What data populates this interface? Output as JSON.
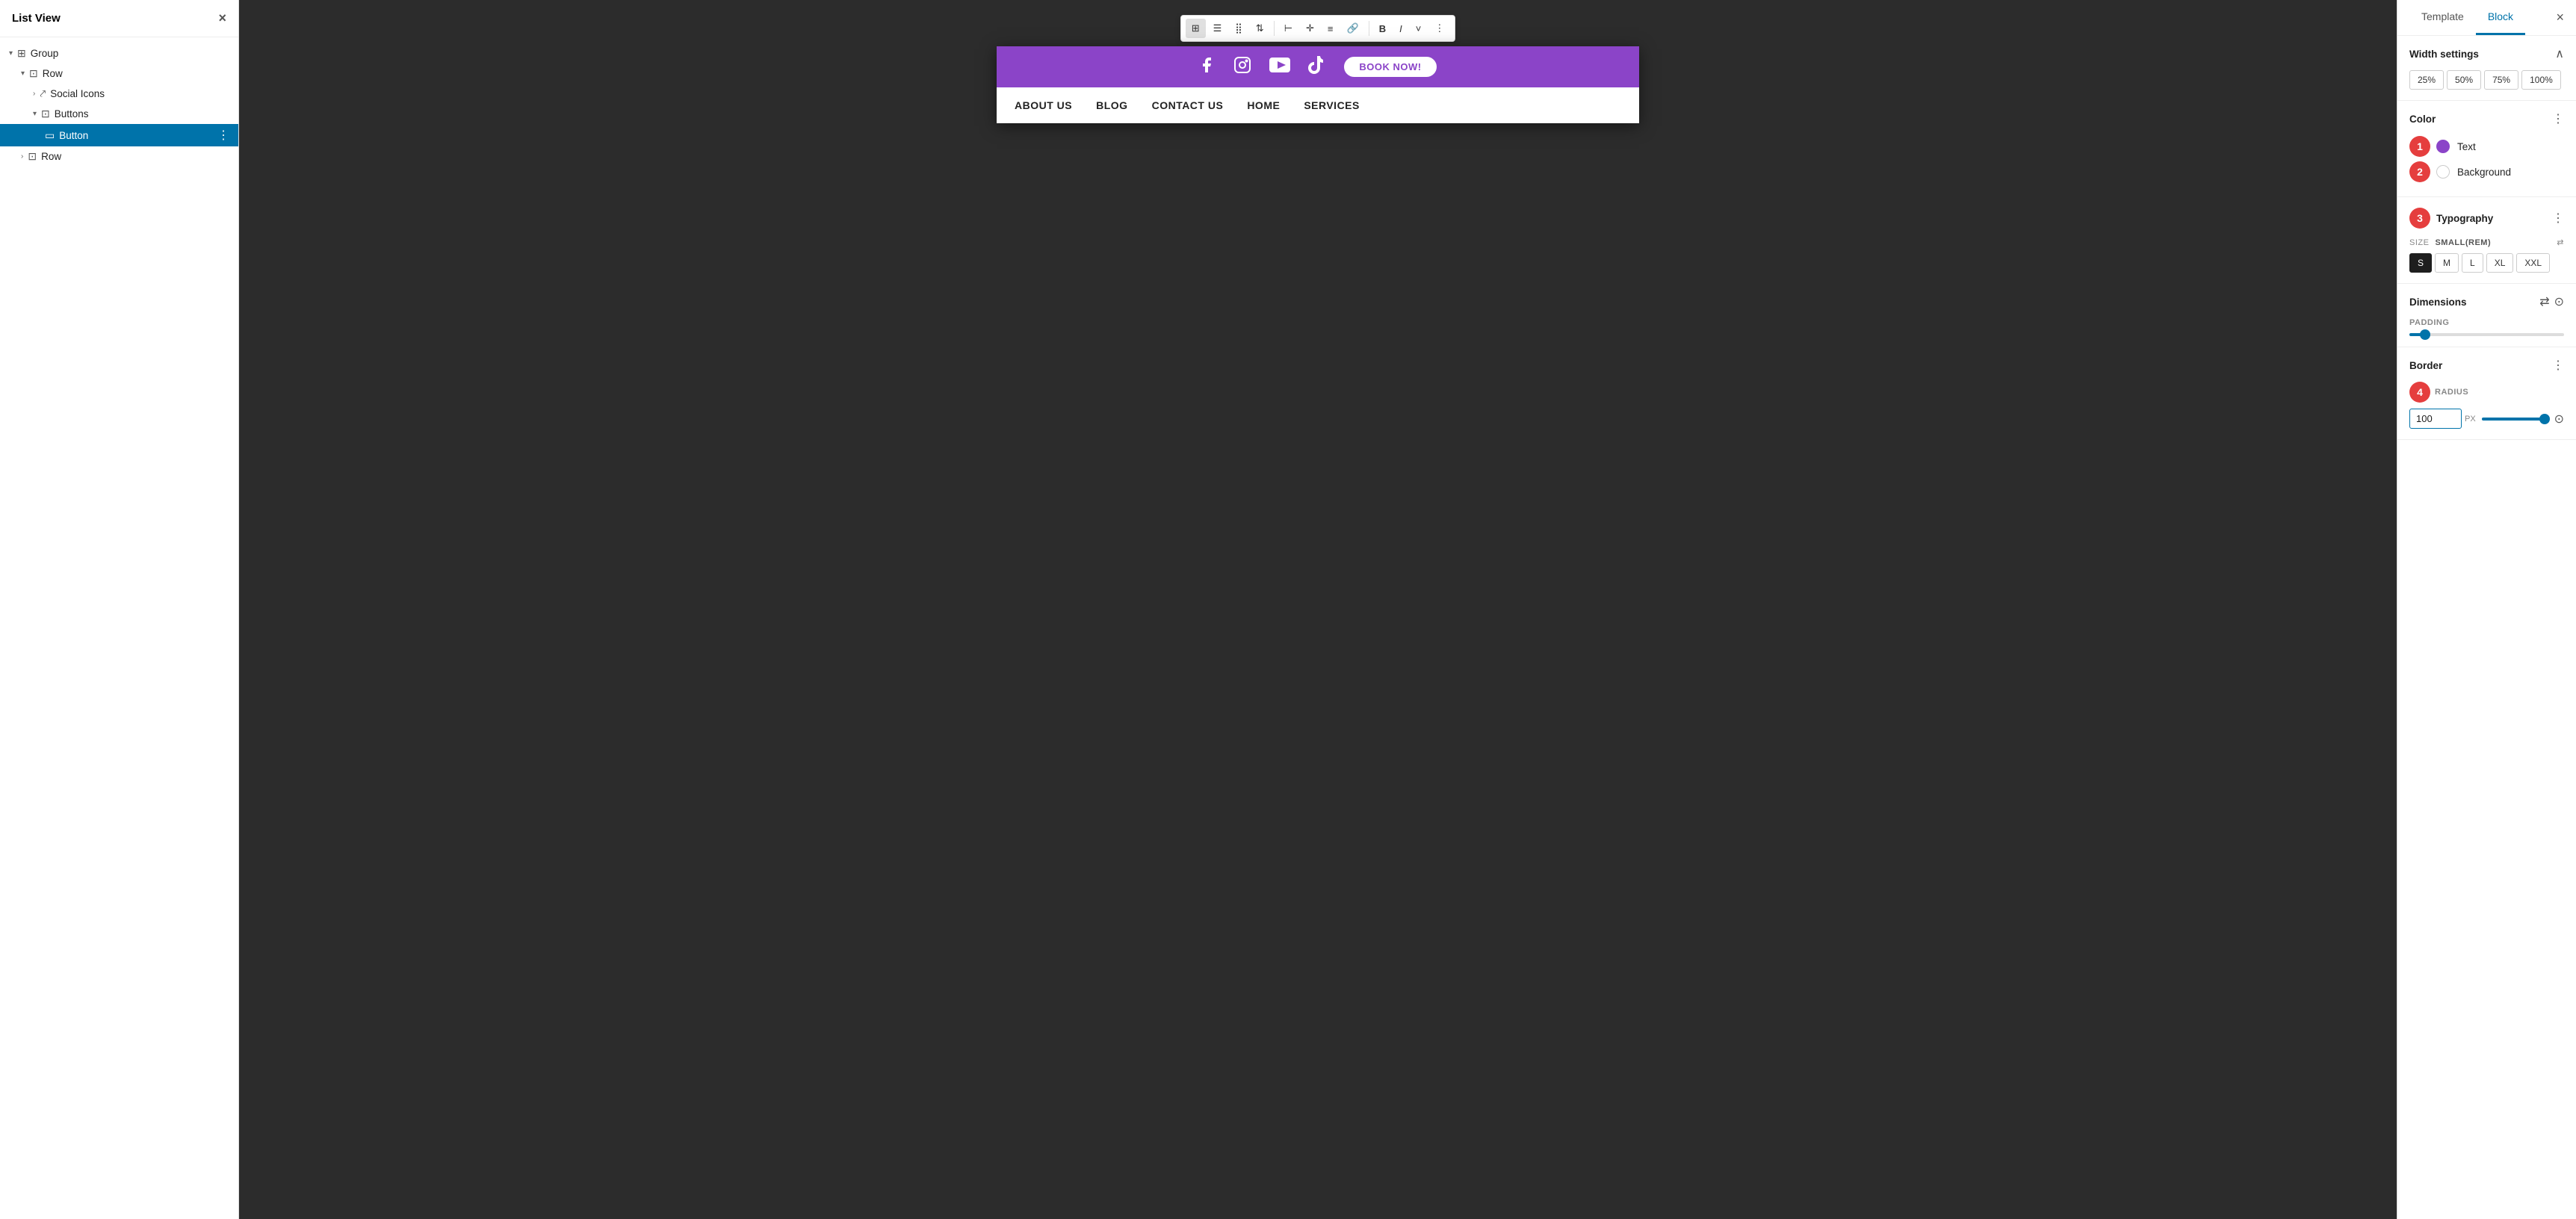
{
  "leftPanel": {
    "title": "List View",
    "closeIcon": "×",
    "tree": [
      {
        "id": "group",
        "label": "Group",
        "icon": "⊞",
        "indent": 0,
        "expanded": true,
        "hasChevron": true
      },
      {
        "id": "row1",
        "label": "Row",
        "icon": "⊡",
        "indent": 1,
        "expanded": true,
        "hasChevron": true
      },
      {
        "id": "social-icons",
        "label": "Social Icons",
        "icon": "⤤",
        "indent": 2,
        "expanded": false,
        "hasChevron": true
      },
      {
        "id": "buttons",
        "label": "Buttons",
        "icon": "⊡",
        "indent": 2,
        "expanded": true,
        "hasChevron": true
      },
      {
        "id": "button",
        "label": "Button",
        "icon": "▭",
        "indent": 3,
        "selected": true,
        "hasMore": true
      },
      {
        "id": "row2",
        "label": "Row",
        "icon": "⊡",
        "indent": 1,
        "expanded": false,
        "hasChevron": true
      }
    ]
  },
  "canvas": {
    "socialBar": {
      "icons": [
        "facebook",
        "instagram",
        "youtube",
        "tiktok"
      ],
      "bookButtonLabel": "BOOK NOW!"
    },
    "navBar": {
      "items": [
        "ABOUT US",
        "BLOG",
        "CONTACT US",
        "HOME",
        "SERVICES"
      ]
    }
  },
  "toolbar": {
    "buttons": [
      {
        "id": "block-icon",
        "icon": "⊞",
        "tooltip": "Block"
      },
      {
        "id": "align-icon",
        "icon": "☰",
        "tooltip": "Align"
      },
      {
        "id": "drag-icon",
        "icon": "⣿",
        "tooltip": "Drag"
      },
      {
        "id": "up-down",
        "icon": "⇅",
        "tooltip": "Move"
      },
      {
        "id": "align-left",
        "icon": "⊢",
        "tooltip": "Align Left"
      },
      {
        "id": "align-center",
        "icon": "✛",
        "tooltip": "Align Center"
      },
      {
        "id": "align-justify",
        "icon": "≡",
        "tooltip": "Align Justify"
      },
      {
        "id": "link",
        "icon": "🔗",
        "tooltip": "Link"
      },
      {
        "id": "bold",
        "icon": "B",
        "tooltip": "Bold"
      },
      {
        "id": "italic",
        "icon": "I",
        "tooltip": "Italic"
      },
      {
        "id": "more",
        "icon": "⋮",
        "tooltip": "More"
      }
    ]
  },
  "rightPanel": {
    "tabs": [
      "Template",
      "Block"
    ],
    "activeTab": "Block",
    "closeIcon": "×",
    "widthSettings": {
      "label": "Width settings",
      "options": [
        "25%",
        "50%",
        "75%",
        "100%"
      ]
    },
    "color": {
      "label": "Color",
      "moreIcon": "⋮",
      "options": [
        {
          "id": "text",
          "label": "Text",
          "colorClass": "purple",
          "badge": "1"
        },
        {
          "id": "background",
          "label": "Background",
          "colorClass": "white",
          "badge": "2"
        }
      ]
    },
    "typography": {
      "label": "Typography",
      "moreIcon": "⋮",
      "sizeLabel": "SIZE",
      "sizeName": "SMALL(REM)",
      "badge": "3",
      "sizes": [
        "S",
        "M",
        "L",
        "XL",
        "XXL"
      ],
      "activeSize": "S"
    },
    "dimensions": {
      "label": "Dimensions",
      "moreIcon": "⋮",
      "paddingLabel": "PADDING",
      "paddingValue": 10,
      "paddingMin": 0,
      "paddingMax": 100,
      "paddingFillPct": 10
    },
    "border": {
      "label": "Border",
      "moreIcon": "⋮",
      "radiusLabel": "RADIUS",
      "badge": "4",
      "radiusValue": "100",
      "radiusUnit": "PX",
      "radiusFillPct": 95
    }
  }
}
